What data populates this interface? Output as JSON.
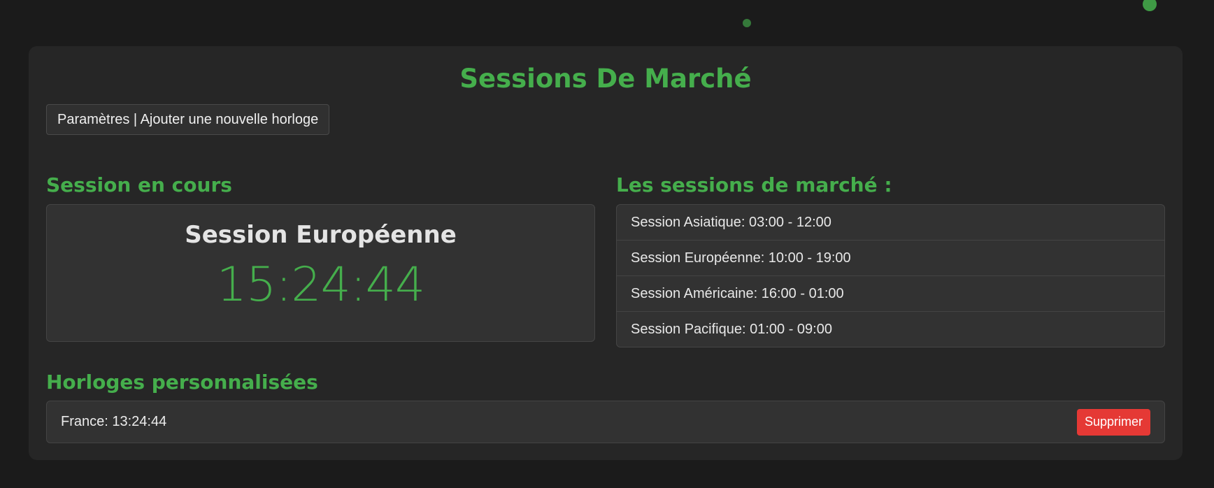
{
  "app": {
    "title": "Sessions De Marché",
    "settings_label": "Paramètres | Ajouter une nouvelle horloge"
  },
  "current_session": {
    "heading": "Session en cours",
    "name": "Session Européenne",
    "time": "15:24:44"
  },
  "market_sessions": {
    "heading": "Les sessions de marché :",
    "items": [
      {
        "label": "Session Asiatique: 03:00 - 12:00"
      },
      {
        "label": "Session Européenne: 10:00 - 19:00"
      },
      {
        "label": "Session Américaine: 16:00 - 01:00"
      },
      {
        "label": "Session Pacifique: 01:00 - 09:00"
      }
    ]
  },
  "custom_clocks": {
    "heading": "Horloges personnalisées",
    "items": [
      {
        "label": "France: 13:24:44",
        "delete_label": "Supprimer"
      }
    ]
  },
  "colors": {
    "accent": "#45ae4c",
    "danger": "#e53935",
    "background": "#1b1b1b",
    "card": "#262626"
  }
}
